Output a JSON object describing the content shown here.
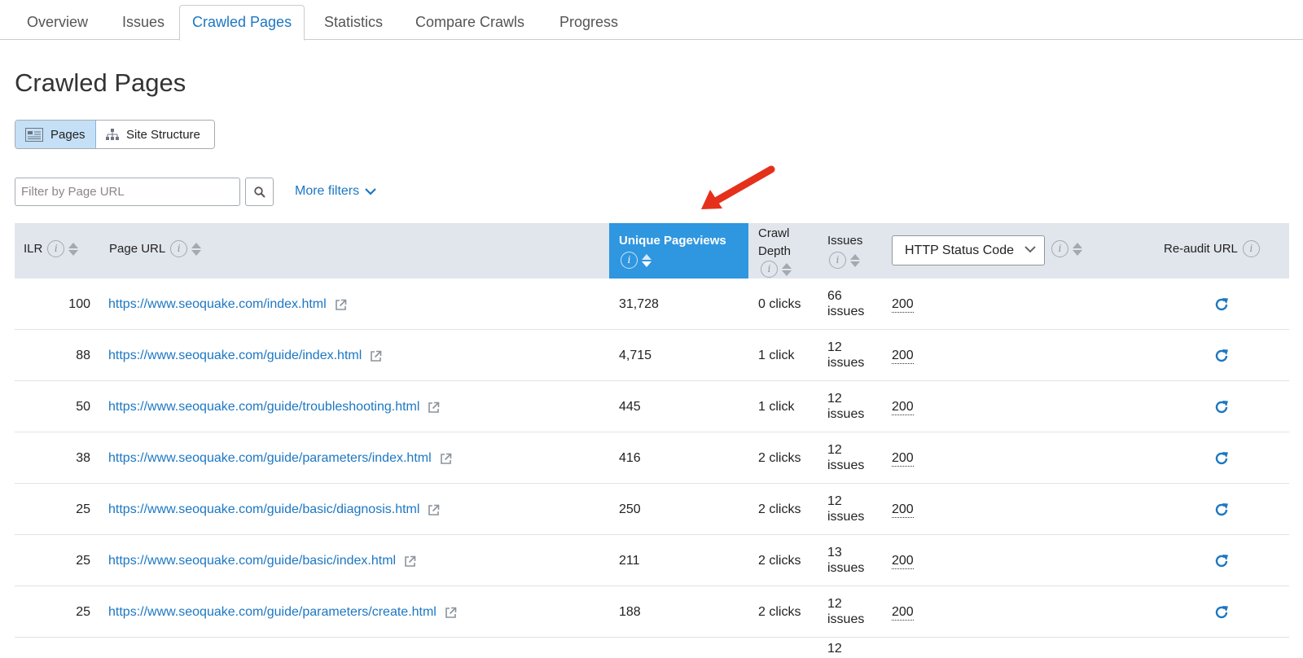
{
  "tabs": [
    {
      "label": "Overview",
      "active": false
    },
    {
      "label": "Issues",
      "active": false
    },
    {
      "label": "Crawled Pages",
      "active": true
    },
    {
      "label": "Statistics",
      "active": false
    },
    {
      "label": "Compare Crawls",
      "active": false
    },
    {
      "label": "Progress",
      "active": false
    }
  ],
  "page_title": "Crawled Pages",
  "view_toggle": {
    "pages_label": "Pages",
    "structure_label": "Site Structure",
    "selected": "Pages"
  },
  "filter": {
    "placeholder": "Filter by Page URL",
    "value": ""
  },
  "more_filters_label": "More filters",
  "table": {
    "headers": {
      "ilr": "ILR",
      "page_url": "Page URL",
      "unique_pageviews": "Unique Pageviews",
      "crawl_depth_line1": "Crawl",
      "crawl_depth_line2": "Depth",
      "issues": "Issues",
      "status_select": "HTTP Status Code",
      "reaudit": "Re-audit URL"
    },
    "rows": [
      {
        "ilr": "100",
        "url": "https://www.seoquake.com/index.html",
        "pageviews": "31,728",
        "depth": "0 clicks",
        "issues_count": "66",
        "issues_word": "issues",
        "status": "200"
      },
      {
        "ilr": "88",
        "url": "https://www.seoquake.com/guide/index.html",
        "pageviews": "4,715",
        "depth": "1 click",
        "issues_count": "12",
        "issues_word": "issues",
        "status": "200"
      },
      {
        "ilr": "50",
        "url": "https://www.seoquake.com/guide/troubleshooting.html",
        "pageviews": "445",
        "depth": "1 click",
        "issues_count": "12",
        "issues_word": "issues",
        "status": "200"
      },
      {
        "ilr": "38",
        "url": "https://www.seoquake.com/guide/parameters/index.html",
        "pageviews": "416",
        "depth": "2 clicks",
        "issues_count": "12",
        "issues_word": "issues",
        "status": "200"
      },
      {
        "ilr": "25",
        "url": "https://www.seoquake.com/guide/basic/diagnosis.html",
        "pageviews": "250",
        "depth": "2 clicks",
        "issues_count": "12",
        "issues_word": "issues",
        "status": "200"
      },
      {
        "ilr": "25",
        "url": "https://www.seoquake.com/guide/basic/index.html",
        "pageviews": "211",
        "depth": "2 clicks",
        "issues_count": "13",
        "issues_word": "issues",
        "status": "200"
      },
      {
        "ilr": "25",
        "url": "https://www.seoquake.com/guide/parameters/create.html",
        "pageviews": "188",
        "depth": "2 clicks",
        "issues_count": "12",
        "issues_word": "issues",
        "status": "200"
      },
      {
        "ilr": "",
        "url": "",
        "pageviews": "",
        "depth": "",
        "issues_count": "12",
        "issues_word": "",
        "status": ""
      }
    ]
  },
  "icons": {
    "info": "info-icon",
    "sort": "sort-icon",
    "external_link": "external-link-icon",
    "reaudit": "refresh-icon",
    "search": "search-icon",
    "chevron": "chevron-down-icon"
  },
  "colors": {
    "accent": "#1c77c3",
    "active_header": "#2f96e0",
    "header_bg": "#e1e6ec",
    "annotation_arrow": "#e5311b"
  }
}
